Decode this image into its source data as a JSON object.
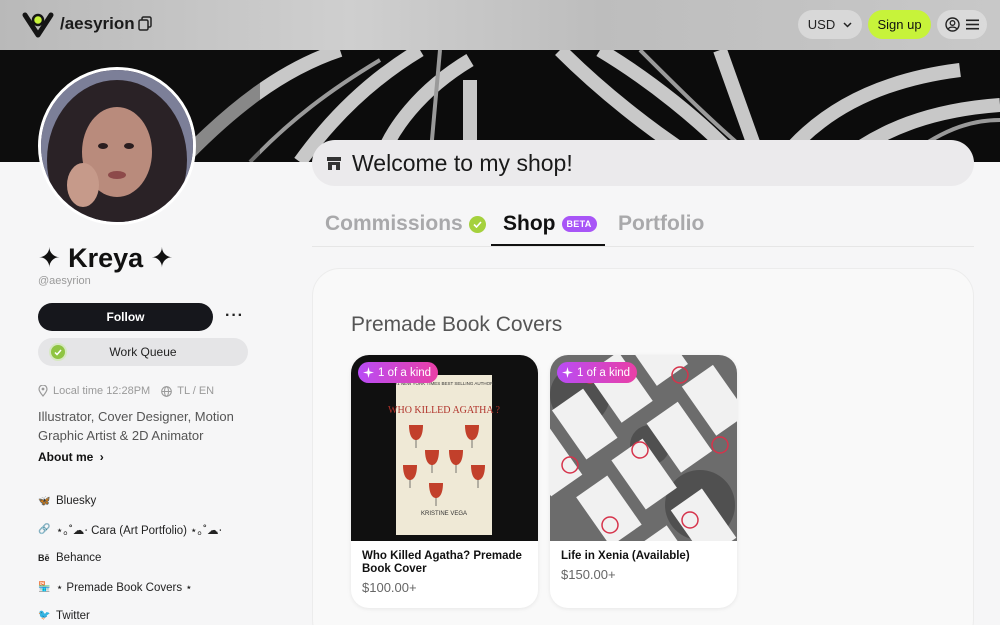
{
  "topbar": {
    "handle": "/aesyrion",
    "currency": "USD",
    "signup_label": "Sign up"
  },
  "profile": {
    "name": "✦ Kreya ✦",
    "username": "@aesyrion",
    "follow_label": "Follow",
    "more_label": "···",
    "work_queue_label": "Work Queue",
    "local_time": "Local time 12:28PM",
    "languages": "TL / EN",
    "bio": "Illustrator, Cover Designer, Motion Graphic Artist & 2D Animator",
    "about_label": "About me",
    "about_chevron": "›"
  },
  "links": [
    {
      "icon": "butterfly-icon",
      "glyph": "🦋",
      "label": "Bluesky"
    },
    {
      "icon": "link-icon",
      "glyph": "🔗",
      "label": "⋆｡˚☁︎⋅ Cara (Art Portfolio) ⋆｡˚☁︎⋅"
    },
    {
      "icon": "behance-icon",
      "glyph": "Bē",
      "label": "Behance"
    },
    {
      "icon": "shop-icon",
      "glyph": "🏪",
      "label": "⋆ Premade Book Covers ⋆"
    },
    {
      "icon": "twitter-icon",
      "glyph": "🐦",
      "label": "Twitter"
    }
  ],
  "shop": {
    "welcome": "Welcome to my shop!",
    "tabs": [
      {
        "label": "Commissions"
      },
      {
        "label": "Shop",
        "badge": "BETA"
      },
      {
        "label": "Portfolio"
      }
    ],
    "section_title": "Premade Book Covers",
    "cards": [
      {
        "badge": "1 of a kind",
        "title": "Who Killed Agatha? Premade Book Cover",
        "price": "$100.00+",
        "cover_top": "#1 NEW YORK TIMES BEST SELLING AUTHOR",
        "cover_title": "WHO KILLED AGATHA ?",
        "cover_author": "KRISTINE VEGA"
      },
      {
        "badge": "1 of a kind",
        "title": "Life in Xenia (Available)",
        "price": "$150.00+"
      }
    ]
  },
  "colors": {
    "accent_green": "#c7f33a",
    "badge_gradient_start": "#b94cf5",
    "badge_gradient_end": "#e93fa6",
    "beta_purple": "#a855f7"
  }
}
